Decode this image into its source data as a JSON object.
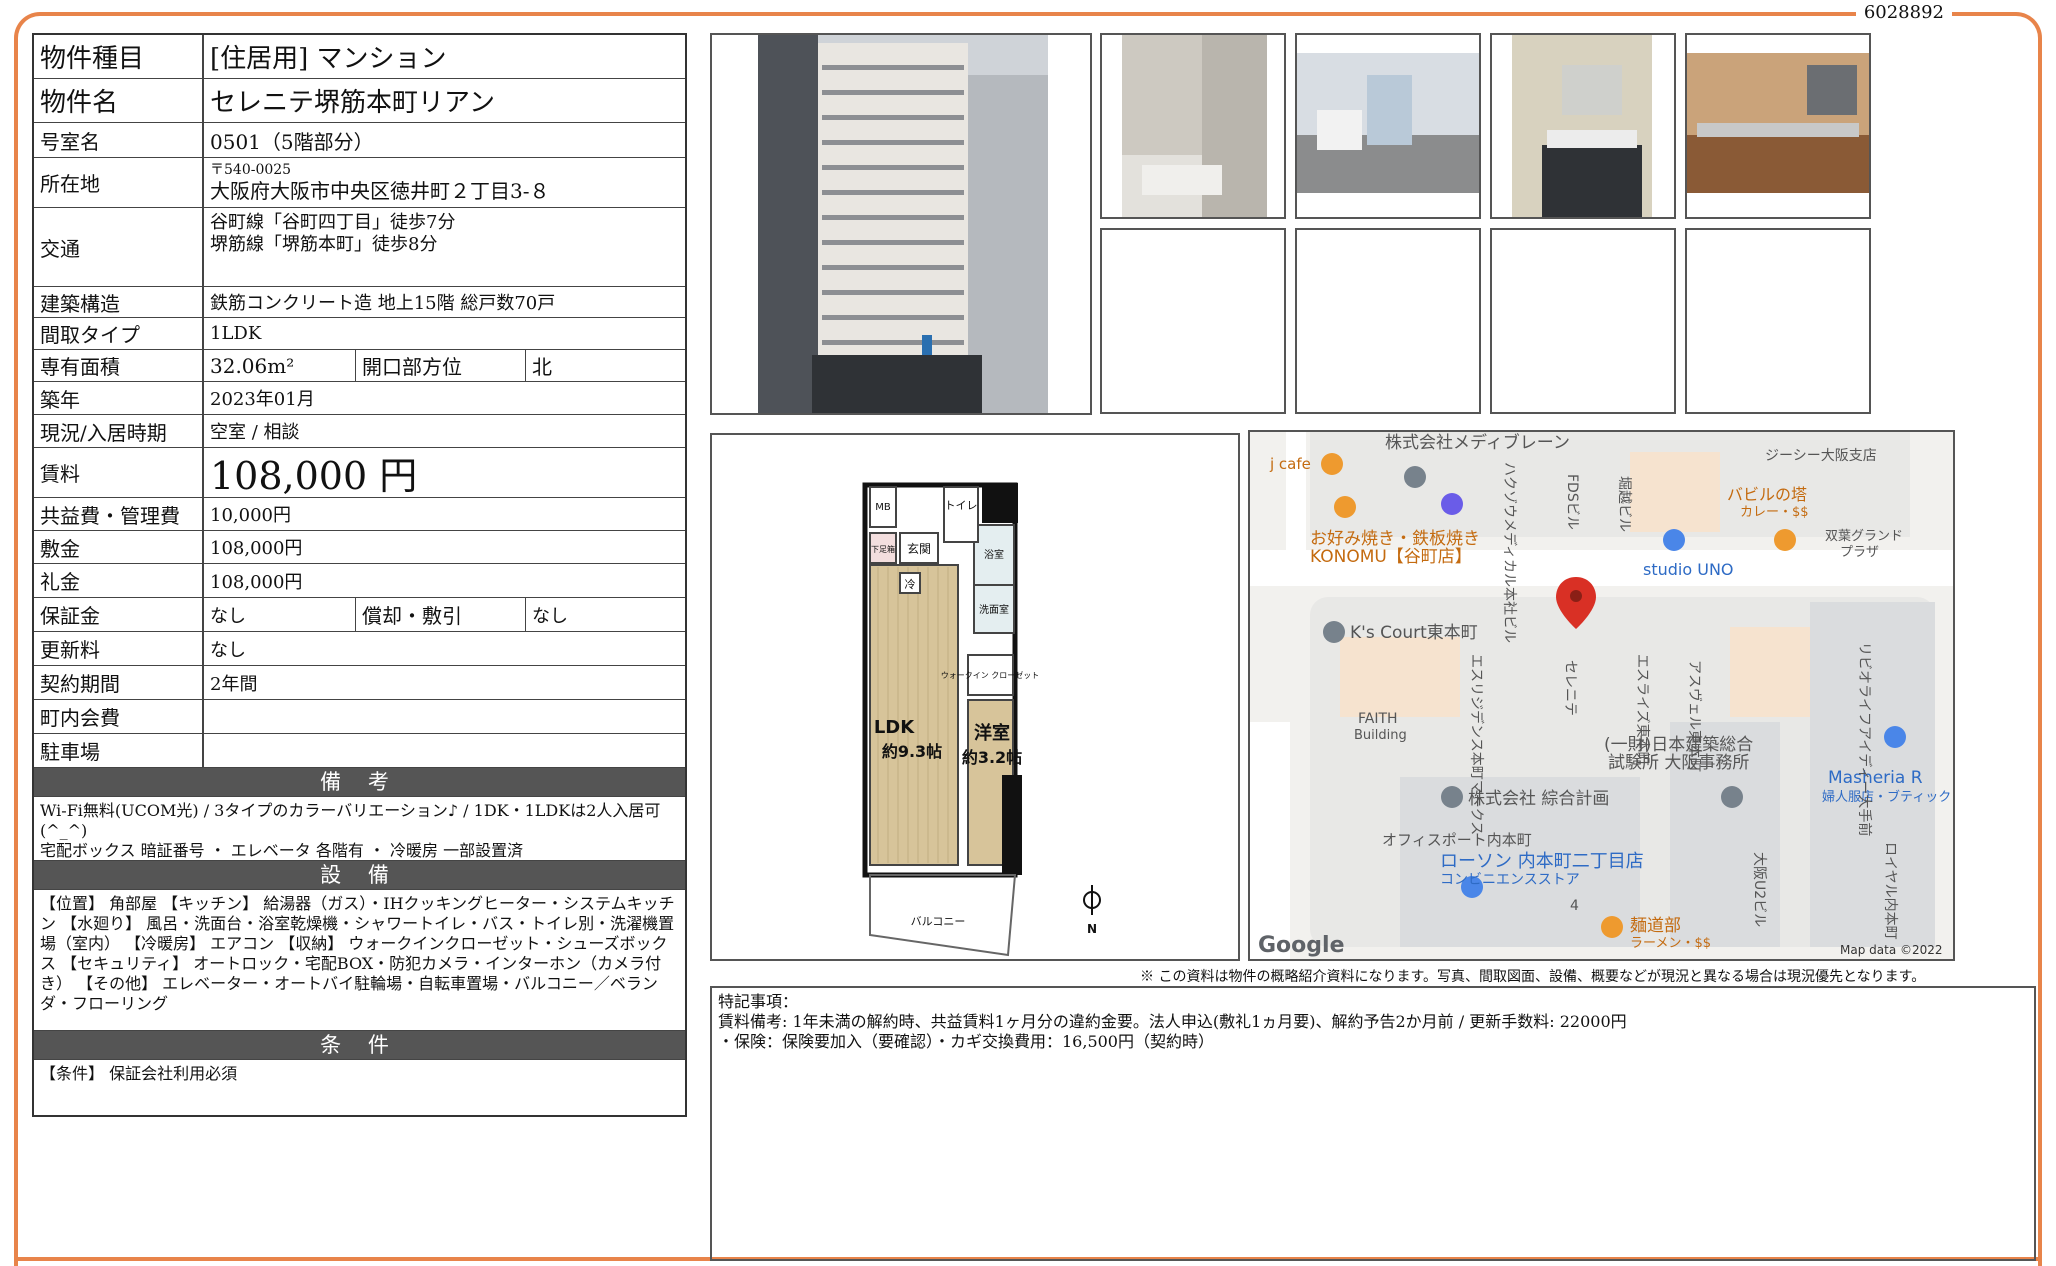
{
  "doc_id": "6028892",
  "rows": {
    "type": {
      "label": "物件種目",
      "value": "[住居用] マンション"
    },
    "name": {
      "label": "物件名",
      "value": "セレニテ堺筋本町リアン"
    },
    "room": {
      "label": "号室名",
      "value": "0501（5階部分）"
    },
    "address": {
      "label": "所在地",
      "zip": "〒540-0025",
      "value": "大阪府大阪市中央区徳井町２丁目3-８"
    },
    "transit": {
      "label": "交通",
      "line1": "谷町線「谷町四丁目」徒歩7分",
      "line2": "堺筋線「堺筋本町」徒歩8分"
    },
    "structure": {
      "label": "建築構造",
      "value": "鉄筋コンクリート造 地上15階 総戸数70戸"
    },
    "layout": {
      "label": "間取タイプ",
      "value": "1LDK"
    },
    "area": {
      "label": "専有面積",
      "value": "32.06m²",
      "label2": "開口部方位",
      "value2": "北"
    },
    "built": {
      "label": "築年",
      "value": "2023年01月"
    },
    "status": {
      "label": "現況/入居時期",
      "value": "空室 / 相談"
    },
    "rent": {
      "label": "賃料",
      "value": "108,000 円"
    },
    "fee": {
      "label": "共益費・管理費",
      "value": "10,000円"
    },
    "deposit": {
      "label": "敷金",
      "value": "108,000円"
    },
    "key_money": {
      "label": "礼金",
      "value": "108,000円"
    },
    "guarantee": {
      "label": "保証金",
      "value": "なし",
      "label2": "償却・敷引",
      "value2": "なし"
    },
    "renewal": {
      "label": "更新料",
      "value": "なし"
    },
    "contract": {
      "label": "契約期間",
      "value": "2年間"
    },
    "town_fee": {
      "label": "町内会費",
      "value": ""
    },
    "parking": {
      "label": "駐車場",
      "value": ""
    }
  },
  "remarks_section": {
    "title": "備 考",
    "text": "Wi-Fi無料(UCOM光) / 3タイプのカラーバリエーション♪ / 1DK・1LDKは2人入居可(^_^)",
    "text2": "宅配ボックス 暗証番号 ・ エレベータ 各階有 ・ 冷暖房 一部設置済"
  },
  "equipment_section": {
    "title": "設 備",
    "text": "【位置】 角部屋 【キッチン】 給湯器（ガス）・IHクッキングヒーター・システムキッチン 【水廻り】 風呂・洗面台・浴室乾燥機・シャワートイレ・バス・トイレ別・洗濯機置場（室内） 【冷暖房】 エアコン 【収納】 ウォークインクローゼット・シューズボックス 【セキュリティ】 オートロック・宅配BOX・防犯カメラ・インターホン（カメラ付き） 【その他】 エレベーター・オートバイ駐輪場・自転車置場・バルコニー／ベランダ・フローリング"
  },
  "conditions_section": {
    "title": "条 件",
    "text": "【条件】 保証会社利用必須"
  },
  "floorplan": {
    "ldk": "LDK",
    "ldk_size": "約9.3帖",
    "western": "洋室",
    "western_size": "約3.2帖",
    "entrance": "玄関",
    "toilet": "トイレ",
    "bath": "浴室",
    "washroom": "洗面室",
    "wic": "ウォークイン クローゼット",
    "balcony": "バルコニー",
    "mb": "MB",
    "shoes": "下足箱",
    "fridge": "冷",
    "north": "N"
  },
  "map": {
    "labels": {
      "l1": "株式会社メディブレーン",
      "l2": "j cafe",
      "l3": "お好み焼き・鉄板焼き",
      "l4": "KONOMU【谷町店】",
      "l5": "ジーシー大阪支店",
      "l6": "バビルの塔",
      "l7": "カレー・$$",
      "l8": "双葉グランド",
      "l9": "プラザ",
      "l10": "studio UNO",
      "l11": "K's Court東本町",
      "l12": "FAITH",
      "l13": "Building",
      "l14": "(一財)日本建築総合",
      "l15": "試験所 大阪事務所",
      "l16": "株式会社 綜合計画",
      "l17": "オフィスポート内本町",
      "l18": "ローソン 内本町二丁目店",
      "l19": "コンビニエンスストア",
      "l20": "麺道部",
      "l21": "ラーメン・$$",
      "l22": "Masheria R",
      "l23": "婦人服店・ブティック",
      "v1": "ハクゾウメディカル本社ビル",
      "v2": "FDSビル",
      "v3": "堀越ビル",
      "v4": "エスリジデンス本町マークス",
      "v5": "セレニテ",
      "v6": "エスライズ東本町",
      "v7": "アスヴェル東本町",
      "v8": "リビオライフアイディー大手前",
      "v9": "大阪U2ビル",
      "v10": "ロイヤル内本町",
      "google": "Google",
      "mapdata": "Map data ©2022",
      "num": "4"
    }
  },
  "disclaimer": "※ この資料は物件の概略紹介資料になります。写真、間取図面、設備、概要などが現況と異なる場合は現況優先となります。",
  "special": {
    "title": "特記事項：",
    "line1": "賃料備考: 1年未満の解約時、共益賃料1ヶ月分の違約金要。法人申込(敷礼1ヵ月要)、解約予告2か月前 / 更新手数料: 22000円",
    "line2": "・保険：保険要加入（要確認）・カギ交換費用：16,500円（契約時）"
  }
}
